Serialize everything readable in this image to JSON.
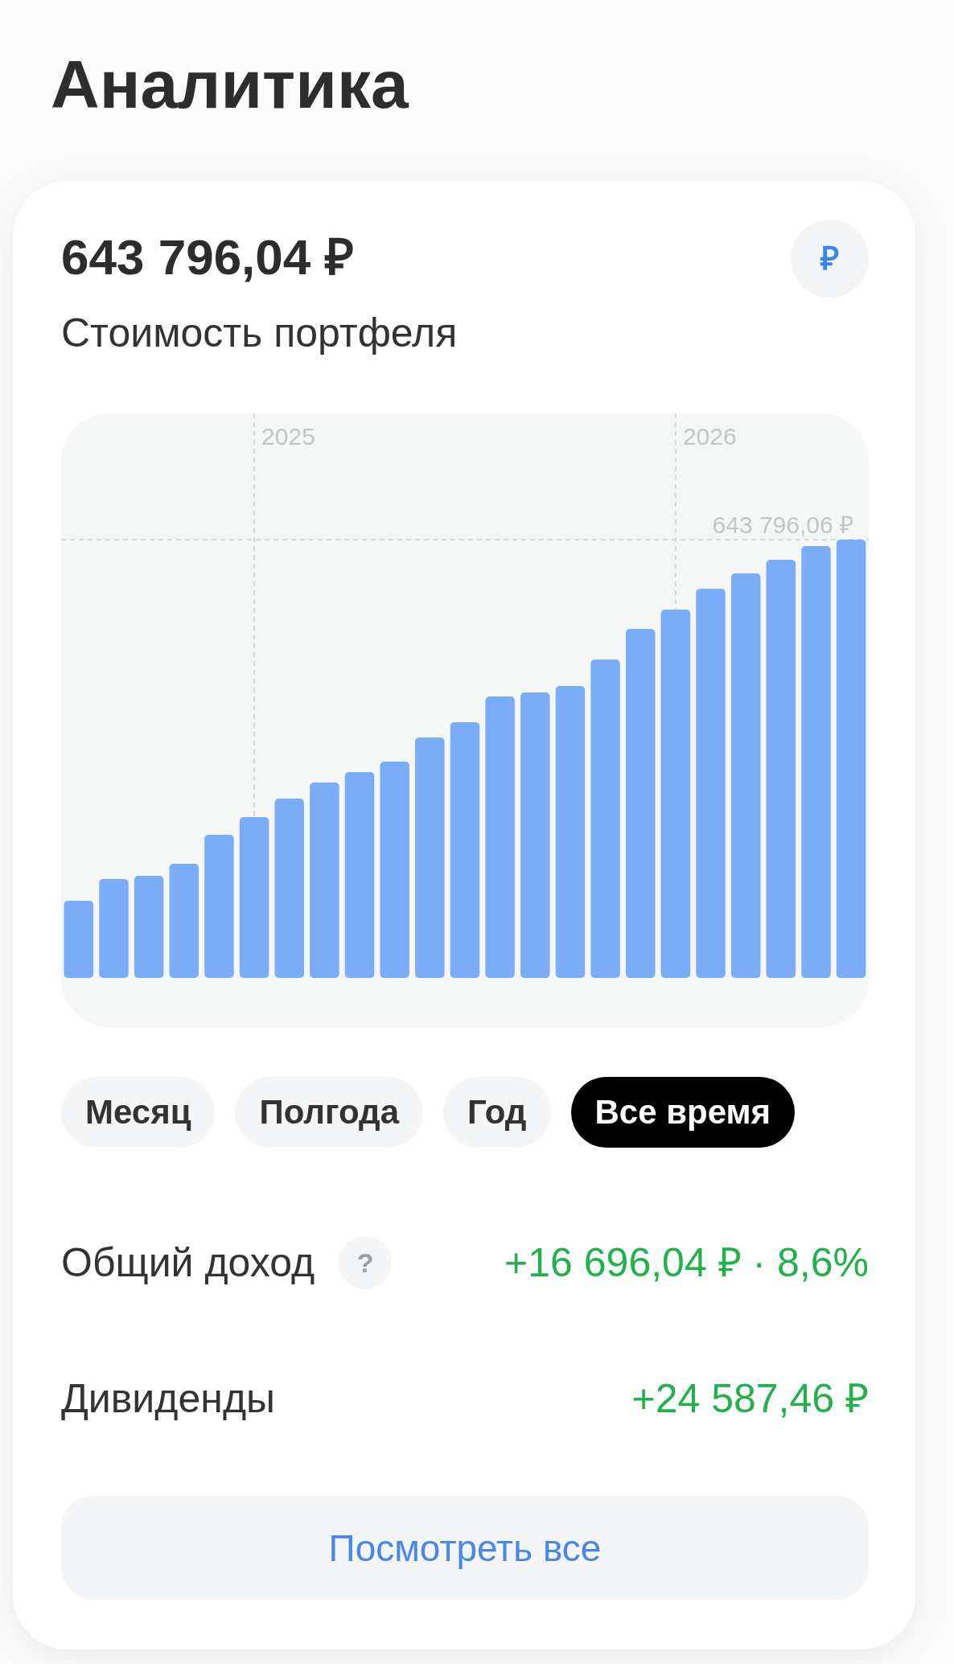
{
  "title": "Аналитика",
  "portfolio": {
    "value": "643 796,04 ₽",
    "caption": "Стоимость портфеля",
    "currency_button": "₽"
  },
  "chart": {
    "year_labels": [
      "2025",
      "2026"
    ],
    "max_label": "643 796,06 ₽"
  },
  "periods": [
    {
      "label": "Месяц",
      "selected": false
    },
    {
      "label": "Полгода",
      "selected": false
    },
    {
      "label": "Год",
      "selected": false
    },
    {
      "label": "Все время",
      "selected": true
    }
  ],
  "stats": [
    {
      "label": "Общий доход",
      "help": "?",
      "value": "+16 696,04 ₽ · 8,6%"
    },
    {
      "label": "Дивиденды",
      "value": "+24 587,46 ₽"
    }
  ],
  "view_all_button": "Посмотреть все"
}
